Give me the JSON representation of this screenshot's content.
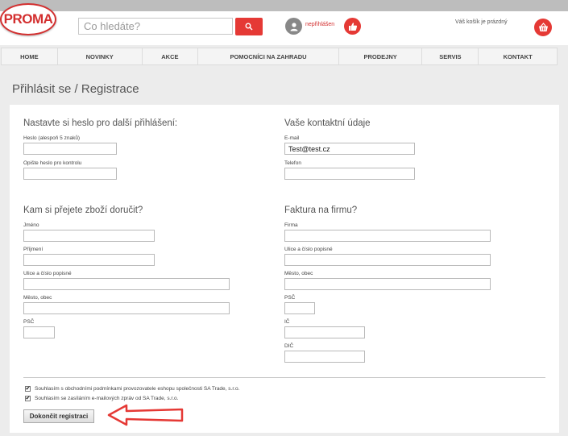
{
  "header": {
    "logo_text": "PROMA",
    "search_placeholder": "Co hledáte?",
    "login_status": "nepřihlášen",
    "cart_text": "Váš košík je prázdný"
  },
  "nav": {
    "items": [
      {
        "label": "HOME"
      },
      {
        "label": "NOVINKY"
      },
      {
        "label": "AKCE"
      },
      {
        "label": "POMOCNÍCI NA ZAHRADU"
      },
      {
        "label": "PRODEJNY"
      },
      {
        "label": "SERVIS"
      },
      {
        "label": "KONTAKT"
      }
    ]
  },
  "page": {
    "title": "Přihlásit se / Registrace"
  },
  "password_section": {
    "title": "Nastavte si heslo pro další přihlášení:",
    "password_label": "Heslo (alespoň 5 znaků)",
    "password_value": "",
    "confirm_label": "Opište heslo pro kontrolu",
    "confirm_value": ""
  },
  "contact_section": {
    "title": "Vaše kontaktní údaje",
    "email_label": "E-mail",
    "email_value": "Test@test.cz",
    "phone_label": "Telefon",
    "phone_value": ""
  },
  "delivery_section": {
    "title": "Kam si přejete zboží doručit?",
    "name_label": "Jméno",
    "surname_label": "Příjmení",
    "street_label": "Ulice a číslo popisné",
    "city_label": "Město, obec",
    "zip_label": "PSČ"
  },
  "invoice_section": {
    "title": "Faktura na firmu?",
    "company_label": "Firma",
    "street_label": "Ulice a číslo popisné",
    "city_label": "Město, obec",
    "zip_label": "PSČ",
    "ic_label": "IČ",
    "dic_label": "DIČ"
  },
  "consents": {
    "terms_label": "Souhlasím s obchodními podmínkami provozovatele eshopu společnosti SA Trade, s.r.o.",
    "terms_checked": true,
    "newsletter_label": "Souhlasím se zasíláním e-mailových zpráv od SA Trade, s.r.o.",
    "newsletter_checked": true,
    "check_mark": "✔"
  },
  "form": {
    "submit_label": "Dokončit registraci"
  },
  "colors": {
    "brand_red": "#e53935",
    "arrow_red": "#e53935"
  },
  "icons": {
    "search": "magnifier",
    "user": "person",
    "like": "thumbs-up",
    "cart": "basket",
    "annotation": "arrow-left"
  }
}
